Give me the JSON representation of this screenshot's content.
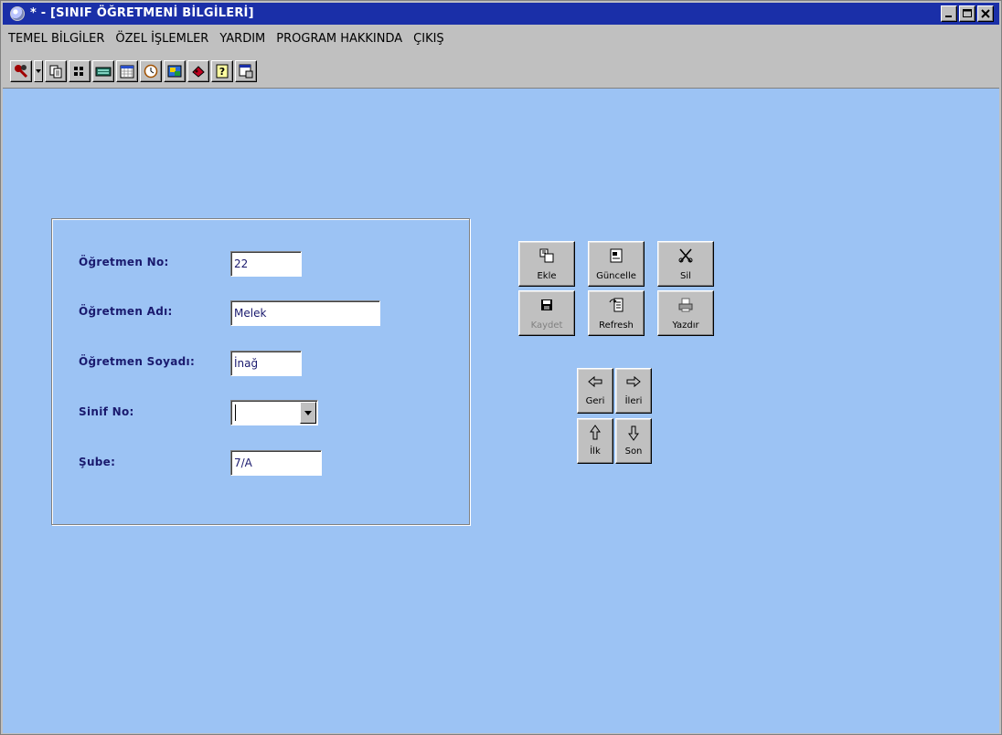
{
  "window": {
    "title": "* - [SINIF ÖĞRETMENİ BİLGİLERİ]"
  },
  "menu": [
    {
      "label": "TEMEL BİLGİLER"
    },
    {
      "label": "ÖZEL İŞLEMLER"
    },
    {
      "label": "YARDIM"
    },
    {
      "label": "PROGRAM HAKKINDA"
    },
    {
      "label": "ÇIKIŞ"
    }
  ],
  "toolbar": {
    "icons": [
      "tools-icon",
      "copy-icon",
      "grid-icon",
      "keyboard-icon",
      "calendar-icon",
      "clock-icon",
      "picture-icon",
      "paint-icon",
      "help-icon",
      "window-icon"
    ]
  },
  "form": {
    "teacher_no": {
      "label": "Öğretmen No:",
      "value": "22"
    },
    "teacher_name": {
      "label": "Öğretmen Adı:",
      "value": "Melek"
    },
    "teacher_surname": {
      "label": "Öğretmen Soyadı:",
      "value": "İnağ"
    },
    "class_no": {
      "label": "Sinif No:",
      "value": ""
    },
    "branch": {
      "label": "Şube:",
      "value": "7/A"
    }
  },
  "actions": {
    "add": "Ekle",
    "update": "Güncelle",
    "delete": "Sil",
    "save": "Kaydet",
    "refresh": "Refresh",
    "print": "Yazdır"
  },
  "navigation": {
    "prev": "Geri",
    "next": "İleri",
    "first": "İlk",
    "last": "Son"
  },
  "colors": {
    "titlebar": "#1a2fa8",
    "workspace": "#9cc3f4",
    "label_text": "#1a1a6e"
  }
}
